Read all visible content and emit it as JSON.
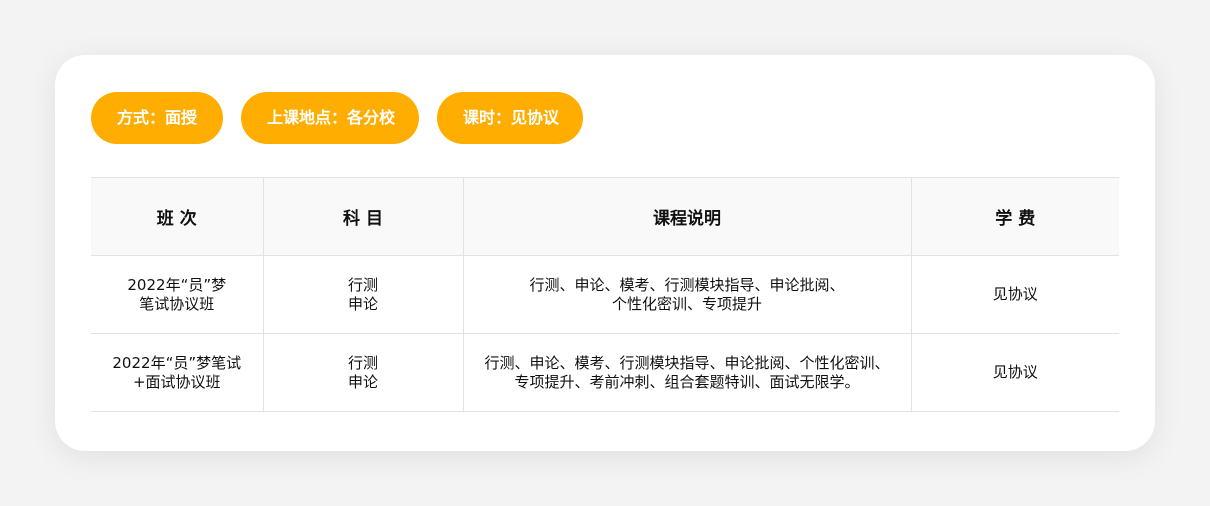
{
  "tags": [
    {
      "label": "方式：面授"
    },
    {
      "label": "上课地点：各分校"
    },
    {
      "label": "课时：见协议"
    }
  ],
  "table": {
    "headers": [
      "班 次",
      "科 目",
      "课程说明",
      "学 费"
    ],
    "rows": [
      {
        "class_name": [
          "2022年“员”梦",
          "笔试协议班"
        ],
        "subjects": [
          "行测",
          "申论"
        ],
        "description": [
          "行测、申论、模考、行测模块指导、申论批阅、",
          "个性化密训、专项提升"
        ],
        "fee": "见协议"
      },
      {
        "class_name": [
          "2022年“员”梦笔试",
          "+面试协议班"
        ],
        "subjects": [
          "行测",
          "申论"
        ],
        "description": [
          "行测、申论、模考、行测模块指导、申论批阅、个性化密训、",
          "专项提升、考前冲刺、组合套题特训、面试无限学。"
        ],
        "fee": "见协议"
      }
    ]
  },
  "colors": {
    "accent": "#ffad00",
    "background": "#f3f3f3",
    "card": "#ffffff",
    "header_bg": "#f9f9f9",
    "border": "#e2e2e2"
  }
}
